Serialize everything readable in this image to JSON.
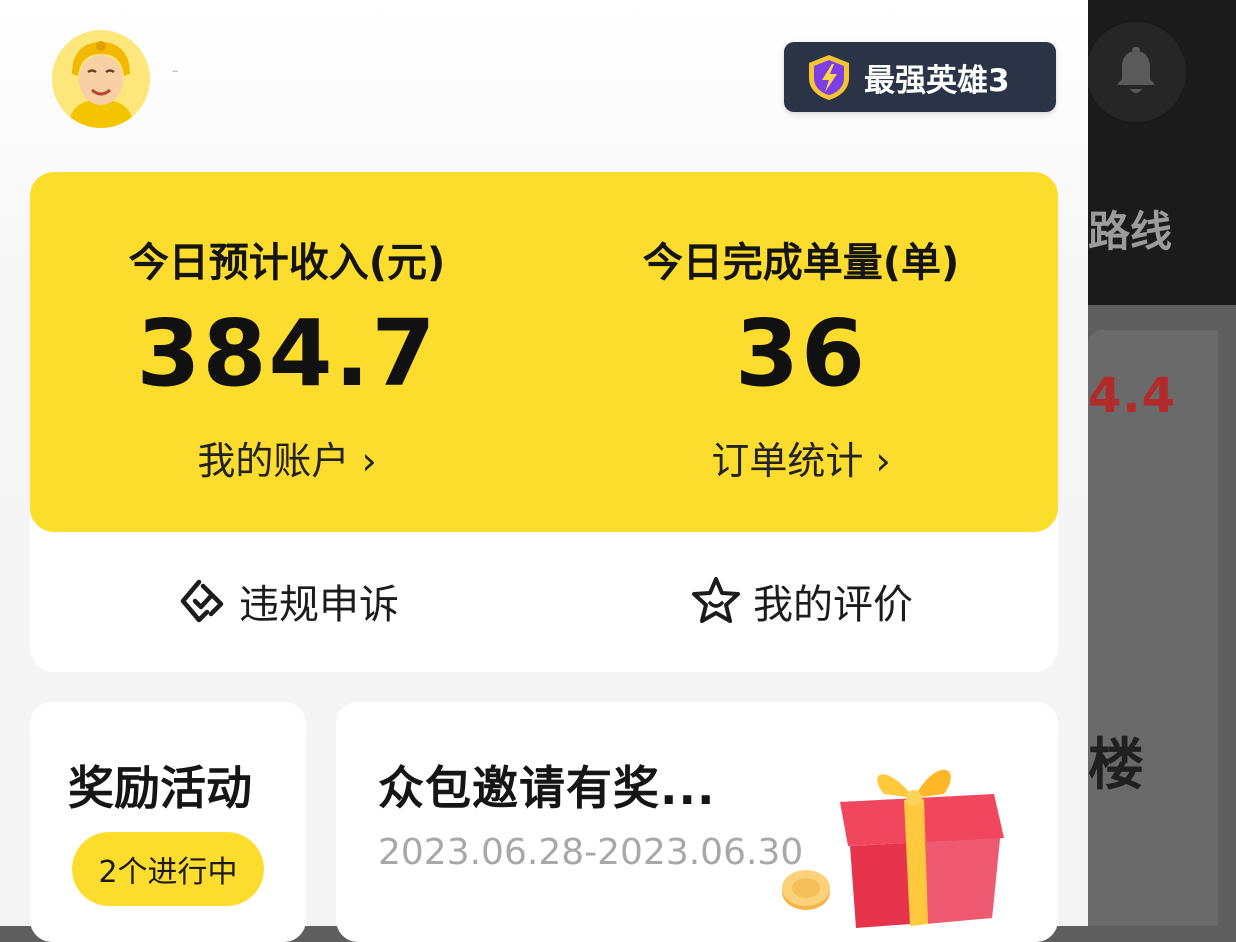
{
  "header": {
    "username": "-",
    "badge_label": "最强英雄3"
  },
  "stats": {
    "income": {
      "label": "今日预计收入(元)",
      "value": "384.7",
      "link": "我的账户 ›"
    },
    "orders": {
      "label": "今日完成单量(单)",
      "value": "36",
      "link": "订单统计 ›"
    }
  },
  "actions": {
    "appeal": {
      "label": "违规申诉",
      "icon": "diamond-check-icon"
    },
    "rating": {
      "label": "我的评价",
      "icon": "star-face-icon"
    }
  },
  "reward": {
    "title": "奖励活动",
    "status": "2个进行中"
  },
  "promo": {
    "title": "众包邀请有奖...",
    "date_range": "2023.06.28-2023.06.30",
    "image": "gift-box-icon"
  },
  "background": {
    "route_text": "路线",
    "number_text": "4.4",
    "floor_text": "楼"
  },
  "colors": {
    "accent_yellow": "#fcdc2c",
    "badge_bg": "#2b3447"
  }
}
